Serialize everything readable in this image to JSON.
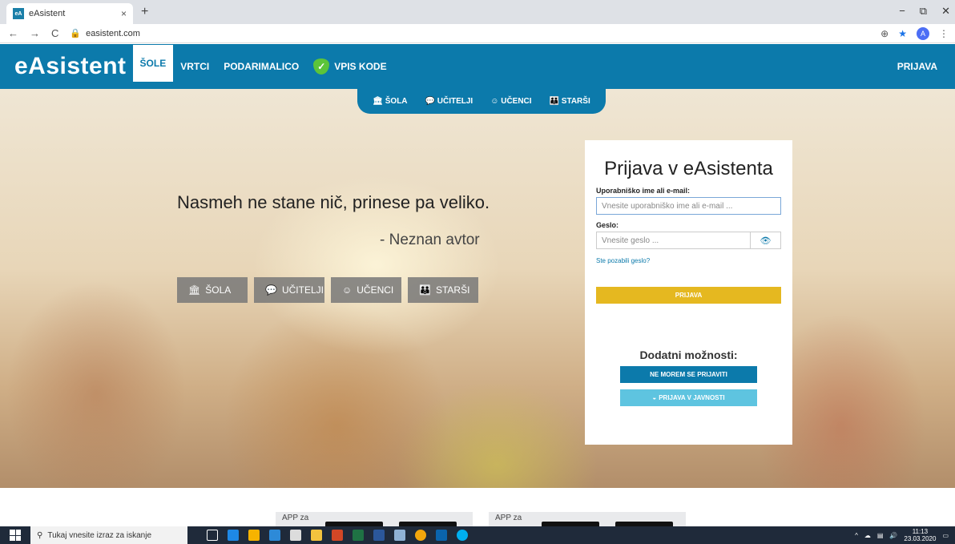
{
  "browser": {
    "tab_title": "eAsistent",
    "tab_favicon": "eA",
    "tab_close": "×",
    "new_tab": "+",
    "url": "easistent.com",
    "profile_initial": "A",
    "nav_back": "←",
    "nav_forward": "→",
    "nav_reload": "C",
    "minimize": "−",
    "restore": "⧉",
    "close": "✕"
  },
  "header": {
    "logo": "eAsistent",
    "nav": [
      "ŠOLE",
      "VRTCI",
      "PODARIMALICO",
      "VPIS KODE"
    ],
    "login": "PRIJAVA"
  },
  "subnav": [
    "ŠOLA",
    "UČITELJI",
    "UČENCI",
    "STARŠI"
  ],
  "hero": {
    "quote": "Nasmeh ne stane nič, prinese pa veliko.",
    "author": "- Neznan avtor",
    "roles": [
      "ŠOLA",
      "UČITELJI",
      "UČENCI",
      "STARŠI"
    ]
  },
  "login": {
    "title": "Prijava v eAsistenta",
    "user_label": "Uporabniško ime ali e-mail:",
    "user_placeholder": "Vnesite uporabniško ime ali e-mail ...",
    "pass_label": "Geslo:",
    "pass_placeholder": "Vnesite geslo ...",
    "forgot": "Ste pozabili geslo?",
    "submit": "PRIJAVA",
    "extra_title": "Dodatni možnosti:",
    "cant_login": "NE MOREM SE PRIJAVITI",
    "public_login": "PRIJAVA V JAVNOSTI"
  },
  "apps": {
    "box1": "APP za",
    "box2": "APP za"
  },
  "taskbar": {
    "search": "Tukaj vnesite izraz za iskanje",
    "time": "11:13",
    "date": "23.03.2020"
  },
  "colors": {
    "brand": "#0c7aab",
    "login_button": "#e5b820",
    "public_button": "#5ec4e0"
  }
}
